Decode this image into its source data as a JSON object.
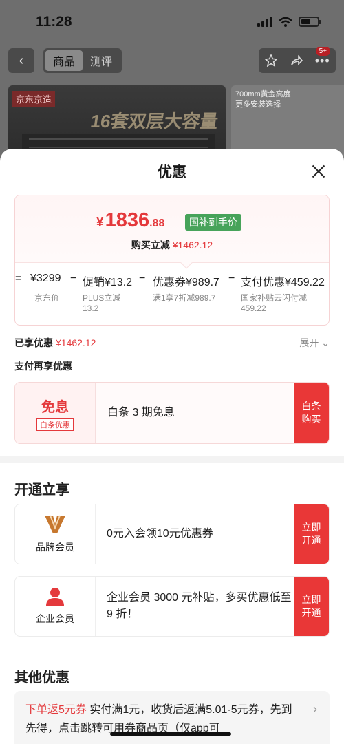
{
  "status_bar": {
    "time": "11:28"
  },
  "nav": {
    "back": "‹",
    "tabs": [
      {
        "label": "商品"
      },
      {
        "label": "测评"
      }
    ],
    "badge": "5+"
  },
  "hero": {
    "brand": "京东京造",
    "title": "16套双层大容量",
    "side_text": "700mm黄金高度\n更多安装选择"
  },
  "sheet": {
    "title": "优惠",
    "price": {
      "currency": "¥",
      "integer": "1836",
      "decimal": ".88",
      "tag": "国补到手价",
      "buy_label": "购买立减",
      "buy_value": "¥1462.12"
    },
    "calc": {
      "eq": "=",
      "jd_price": "¥3299",
      "minus1": "−",
      "promo": "促销¥13.2",
      "minus2": "−",
      "coupon": "优惠券¥989.7",
      "minus3": "−",
      "pay": "支付优惠¥459.22",
      "jd_price_sub": "京东价",
      "promo_sub": "PLUS立减\n13.2",
      "coupon_sub": "满1享7折减989.7",
      "pay_sub": "国家补贴云闪付减\n459.22"
    },
    "enjoyed_label": "已享优惠",
    "enjoyed_value": "¥1462.12",
    "expand": "展开 ⌄",
    "pay_again": "支付再享优惠",
    "baitiao": {
      "left_title": "免息",
      "left_tag": "白条优惠",
      "text": "白条 3 期免息",
      "button": "白条\n购买"
    },
    "open_title": "开通立享",
    "brand_member": {
      "label": "品牌会员",
      "text": "0元入会领10元优惠券",
      "button": "立即\n开通"
    },
    "enterprise_member": {
      "label": "企业会员",
      "text": "企业会员 3000 元补贴，多买优惠低至 9 折！",
      "button": "立即\n开通"
    },
    "other_title": "其他优惠",
    "other": {
      "highlight": "下单返5元券",
      "text": " 实付满1元，收货后返满5.01-5元券，先到先得，点击跳转可用券商品页（仅app可",
      "arrow": "›"
    }
  },
  "colors": {
    "accent": "#e4393c",
    "button": "#e93737",
    "tag_green": "#47a35a"
  }
}
